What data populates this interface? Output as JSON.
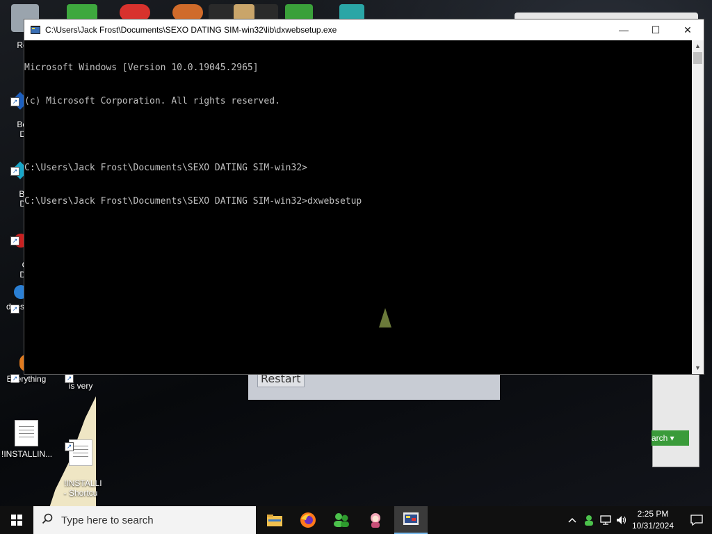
{
  "desktop": {
    "icons": [
      {
        "label": "Recy"
      },
      {
        "label": "Bejev\nDe"
      },
      {
        "label": "Beje\nDe"
      },
      {
        "label": "Ch\nDe"
      },
      {
        "label": "does"
      },
      {
        "label": "Everything"
      },
      {
        "label": "is very"
      },
      {
        "label": "!INSTALLIN..."
      },
      {
        "label": "!INSTALLI\n- Shortcu"
      }
    ]
  },
  "background_dialog": {
    "restart_label": "Restart"
  },
  "background_window": {
    "search_label": "arch"
  },
  "console": {
    "title": "C:\\Users\\Jack Frost\\Documents\\SEXO DATING SIM-win32\\lib\\dxwebsetup.exe",
    "lines": [
      "Microsoft Windows [Version 10.0.19045.2965]",
      "(c) Microsoft Corporation. All rights reserved.",
      "",
      "C:\\Users\\Jack Frost\\Documents\\SEXO DATING SIM-win32>",
      "C:\\Users\\Jack Frost\\Documents\\SEXO DATING SIM-win32>dxwebsetup"
    ],
    "minimize_glyph": "—",
    "maximize_glyph": "☐",
    "close_glyph": "✕"
  },
  "taskbar": {
    "search_placeholder": "Type here to search",
    "apps": [
      "file-explorer-icon",
      "firefox-icon",
      "users-icon",
      "anime-girl-icon",
      "dxwebsetup-icon"
    ],
    "clock_time": "2:25 PM",
    "clock_date": "10/31/2024"
  },
  "colors": {
    "console_bg": "#000000",
    "console_text": "#c0c0c0",
    "taskbar_bg": "#101010",
    "accent": "#76b9ed"
  }
}
